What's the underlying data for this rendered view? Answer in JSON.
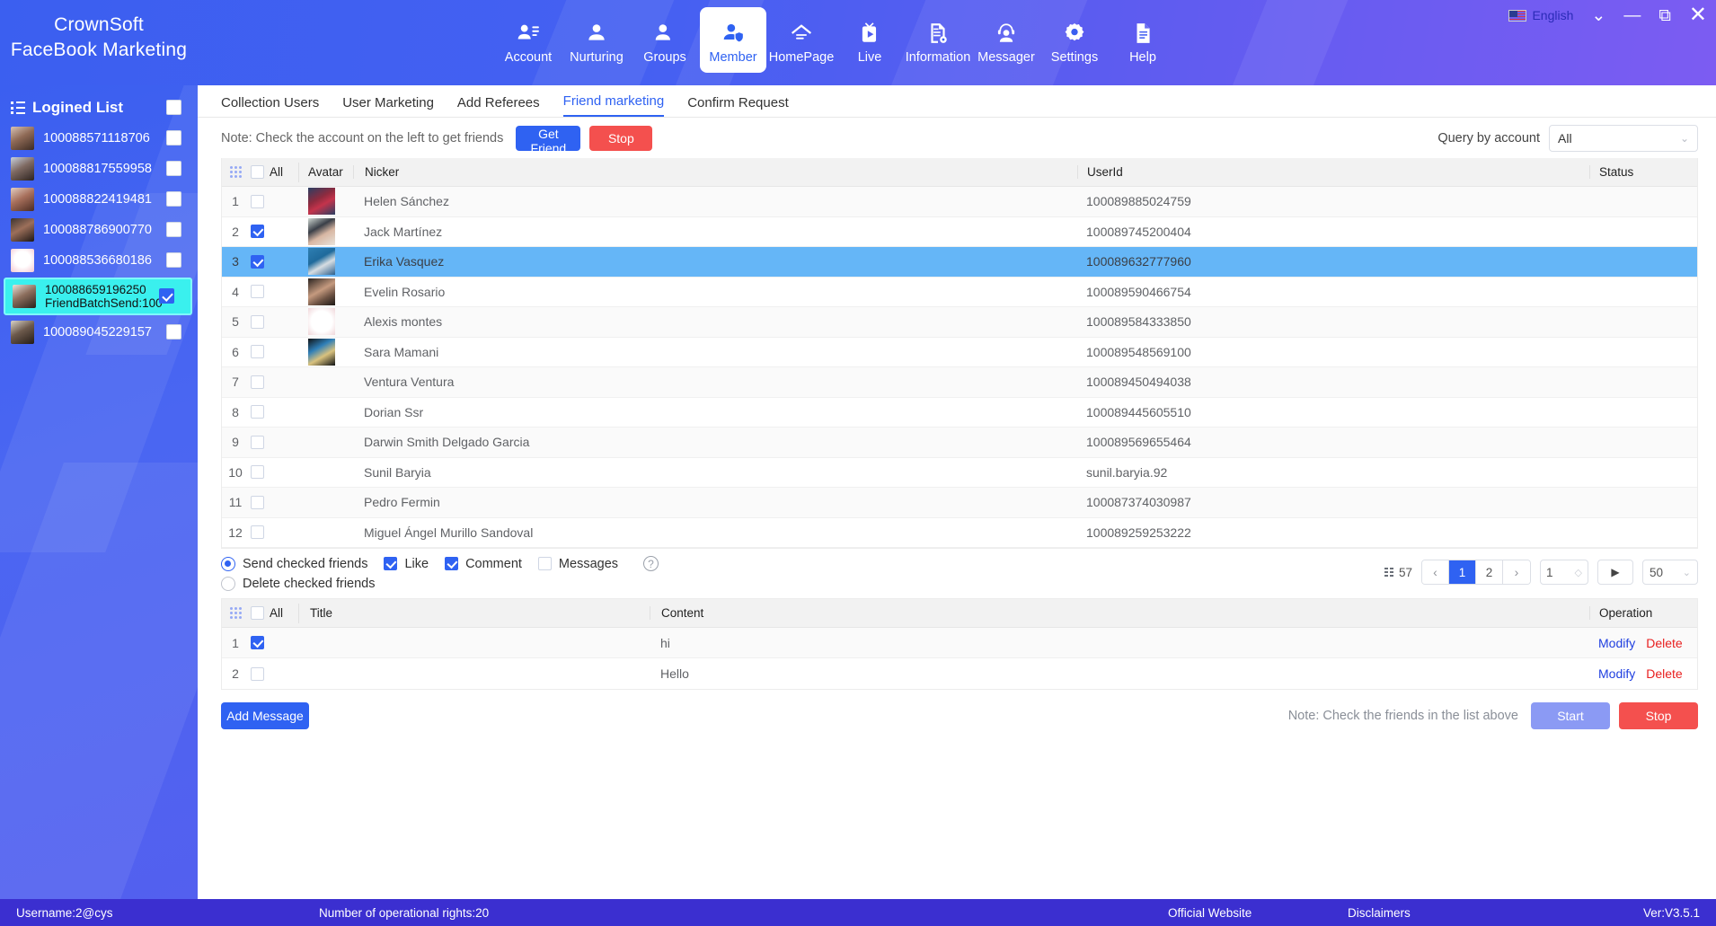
{
  "app": {
    "brand_line1": "CrownSoft",
    "brand_line2": "FaceBook Marketing",
    "language": "English"
  },
  "nav": {
    "items": [
      {
        "label": "Account",
        "icon": "account-list-icon",
        "active": false
      },
      {
        "label": "Nurturing",
        "icon": "person-icon",
        "active": false
      },
      {
        "label": "Groups",
        "icon": "groups-icon",
        "active": false
      },
      {
        "label": "Member",
        "icon": "member-shield-icon",
        "active": true
      },
      {
        "label": "HomePage",
        "icon": "home-icon",
        "active": false
      },
      {
        "label": "Live",
        "icon": "live-tv-icon",
        "active": false
      },
      {
        "label": "Information",
        "icon": "document-icon",
        "active": false
      },
      {
        "label": "Messager",
        "icon": "headset-person-icon",
        "active": false
      },
      {
        "label": "Settings",
        "icon": "gear-icon",
        "active": false
      },
      {
        "label": "Help",
        "icon": "help-doc-icon",
        "active": false
      }
    ]
  },
  "window_controls": {
    "chevron": "chevron-down-icon",
    "minimize": "minimize-icon",
    "maximize": "maximize-icon",
    "close": "close-icon"
  },
  "sidebar": {
    "title": "Logined List",
    "header_checked": false,
    "accounts": [
      {
        "id": "100088571118706",
        "sub": "",
        "checked": false,
        "selected": false
      },
      {
        "id": "100088817559958",
        "sub": "",
        "checked": false,
        "selected": false
      },
      {
        "id": "100088822419481",
        "sub": "",
        "checked": false,
        "selected": false
      },
      {
        "id": "100088786900770",
        "sub": "",
        "checked": false,
        "selected": false
      },
      {
        "id": "100088536680186",
        "sub": "",
        "checked": false,
        "selected": false
      },
      {
        "id": "100088659196250",
        "sub": "FriendBatchSend:100",
        "checked": true,
        "selected": true
      },
      {
        "id": "100089045229157",
        "sub": "",
        "checked": false,
        "selected": false
      }
    ]
  },
  "tabs": [
    {
      "label": "Collection Users",
      "active": false
    },
    {
      "label": "User Marketing",
      "active": false
    },
    {
      "label": "Add Referees",
      "active": false
    },
    {
      "label": "Friend marketing",
      "active": true
    },
    {
      "label": "Confirm Request",
      "active": false
    }
  ],
  "toolbar": {
    "note": "Note: Check the account on the left to get friends",
    "get_friend_label": "Get Friend",
    "stop_label": "Stop",
    "query_label": "Query by account",
    "query_value": "All"
  },
  "friends_table": {
    "columns": {
      "all": "All",
      "avatar": "Avatar",
      "nicker": "Nicker",
      "userid": "UserId",
      "status": "Status"
    },
    "header_checked": false,
    "rows": [
      {
        "idx": "1",
        "checked": false,
        "nicker": "Helen Sánchez",
        "userid": "100089885024759",
        "status": "",
        "avatar": "photo-woman-red-dress",
        "highlight": false
      },
      {
        "idx": "2",
        "checked": true,
        "nicker": "Jack Martínez",
        "userid": "100089745200404",
        "status": "",
        "avatar": "photo-woman-dark-hair",
        "highlight": false
      },
      {
        "idx": "3",
        "checked": true,
        "nicker": "Erika Vasquez",
        "userid": "100089632777960",
        "status": "",
        "avatar": "photo-blue-hair-mask",
        "highlight": true
      },
      {
        "idx": "4",
        "checked": false,
        "nicker": "Evelin Rosario",
        "userid": "100089590466754",
        "status": "",
        "avatar": "photo-woman-hand",
        "highlight": false
      },
      {
        "idx": "5",
        "checked": false,
        "nicker": "Alexis montes",
        "userid": "100089584333850",
        "status": "",
        "avatar": "logo-monogram",
        "highlight": false
      },
      {
        "idx": "6",
        "checked": false,
        "nicker": "Sara Mamani",
        "userid": "100089548569100",
        "status": "",
        "avatar": "photo-person-blue",
        "highlight": false
      },
      {
        "idx": "7",
        "checked": false,
        "nicker": "Ventura Ventura",
        "userid": "100089450494038",
        "status": "",
        "avatar": "",
        "highlight": false
      },
      {
        "idx": "8",
        "checked": false,
        "nicker": "Dorian Ssr",
        "userid": "100089445605510",
        "status": "",
        "avatar": "",
        "highlight": false
      },
      {
        "idx": "9",
        "checked": false,
        "nicker": "Darwin Smith Delgado Garcia",
        "userid": "100089569655464",
        "status": "",
        "avatar": "",
        "highlight": false
      },
      {
        "idx": "10",
        "checked": false,
        "nicker": "Sunil Baryia",
        "userid": "sunil.baryia.92",
        "status": "",
        "avatar": "",
        "highlight": false
      },
      {
        "idx": "11",
        "checked": false,
        "nicker": "Pedro Fermin",
        "userid": "100087374030987",
        "status": "",
        "avatar": "",
        "highlight": false
      },
      {
        "idx": "12",
        "checked": false,
        "nicker": "Miguel Ángel Murillo Sandoval",
        "userid": "100089259253222",
        "status": "",
        "avatar": "",
        "highlight": false
      }
    ]
  },
  "options": {
    "send_checked_label": "Send checked friends",
    "send_checked_selected": true,
    "delete_checked_label": "Delete checked friends",
    "delete_checked_selected": false,
    "like_label": "Like",
    "like_checked": true,
    "comment_label": "Comment",
    "comment_checked": true,
    "messages_label": "Messages",
    "messages_checked": false,
    "help_icon": "question-circle-icon"
  },
  "pagination": {
    "total": "57",
    "pages": [
      "1",
      "2"
    ],
    "current": "1",
    "prev_icon": "chevron-left-icon",
    "next_icon": "chevron-right-icon",
    "jump_value": "1",
    "go_icon": "play-arrow-icon",
    "page_size": "50"
  },
  "message_table": {
    "columns": {
      "all": "All",
      "title": "Title",
      "content": "Content",
      "operation": "Operation"
    },
    "header_checked": false,
    "rows": [
      {
        "idx": "1",
        "checked": true,
        "title": "",
        "content": "hi",
        "modify": "Modify",
        "delete": "Delete"
      },
      {
        "idx": "2",
        "checked": false,
        "title": "",
        "content": "Hello",
        "modify": "Modify",
        "delete": "Delete"
      }
    ]
  },
  "bottom_bar": {
    "add_message_label": "Add Message",
    "note": "Note: Check the friends in the list above",
    "start_label": "Start",
    "stop_label": "Stop"
  },
  "footer": {
    "username": "Username:2@cys",
    "rights": "Number of operational rights:20",
    "website": "Official Website",
    "disclaimers": "Disclaimers",
    "version": "Ver:V3.5.1"
  },
  "colors": {
    "brand_blue": "#2f62f2",
    "danger_red": "#f4504e",
    "highlight_row": "#65b6f7",
    "selected_account": "#3af0ee",
    "footer_purple": "#3b2fd0"
  }
}
